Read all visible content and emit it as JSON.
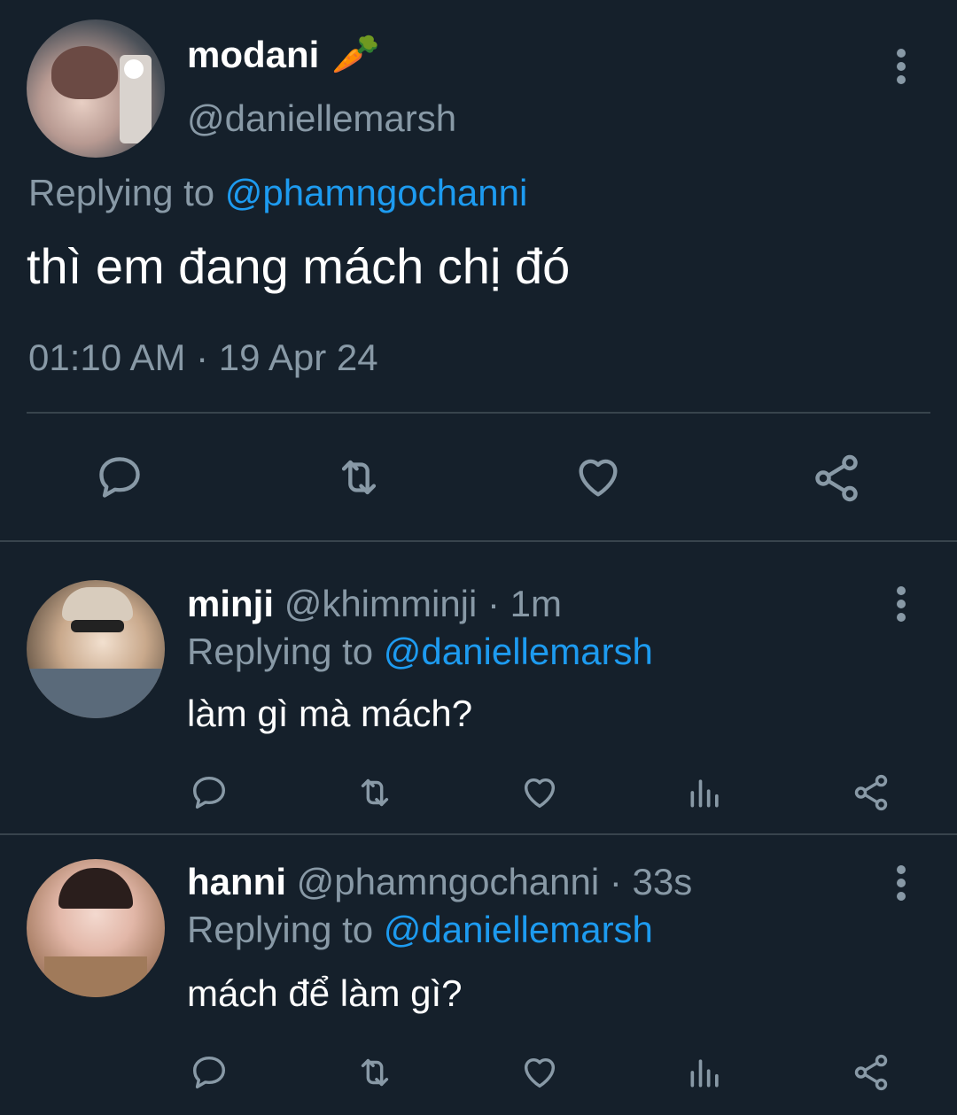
{
  "main_tweet": {
    "display_name": "modani",
    "name_emoji": "🥕",
    "handle": "@daniellemarsh",
    "replying_prefix": "Replying to",
    "replying_to": "@phamngochanni",
    "text": "thì em đang mách chị đó",
    "timestamp": "01:10 AM · 19 Apr 24"
  },
  "replies": [
    {
      "display_name": "minji",
      "handle": "@khimminji",
      "time": "· 1m",
      "replying_prefix": "Replying to",
      "replying_to": "@daniellemarsh",
      "text": "làm gì mà mách?"
    },
    {
      "display_name": "hanni",
      "handle": "@phamngochanni",
      "time": "· 33s",
      "replying_prefix": "Replying to",
      "replying_to": "@daniellemarsh",
      "text": "mách để làm gì?"
    }
  ],
  "icons": {
    "more": "more-vertical-icon",
    "reply": "comment-icon",
    "retweet": "retweet-icon",
    "like": "heart-icon",
    "views": "analytics-icon",
    "share": "share-icon"
  },
  "colors": {
    "background": "#15202b",
    "link": "#1d9bf0",
    "secondary_text": "#8899a6",
    "divider": "#38444d"
  }
}
